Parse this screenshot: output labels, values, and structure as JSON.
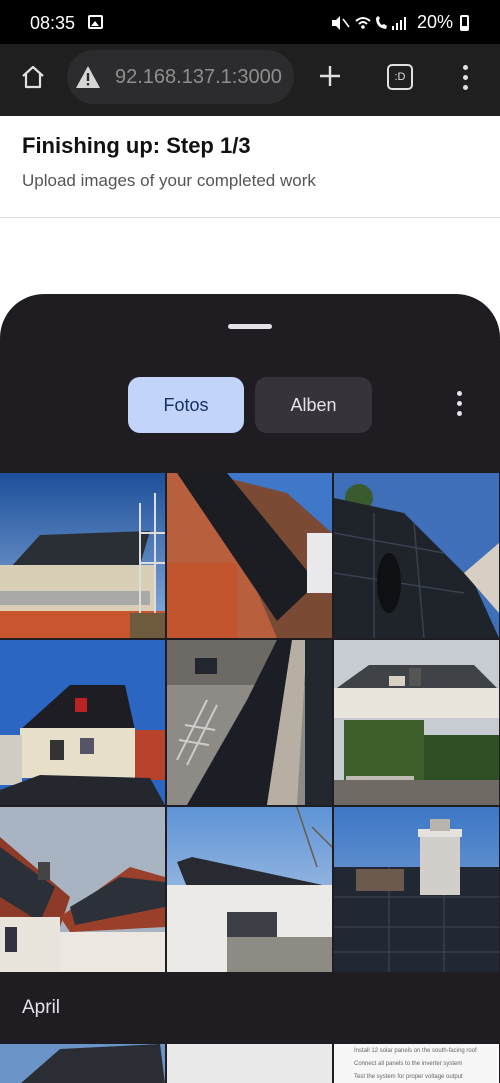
{
  "status_bar": {
    "time": "08:35",
    "battery": "20%"
  },
  "browser": {
    "url": "92.168.137.1:3000",
    "tabs_label": ":D"
  },
  "page": {
    "title": "Finishing up: Step 1/3",
    "subtitle": "Upload images of your completed work"
  },
  "picker": {
    "tabs": [
      {
        "label": "Fotos",
        "selected": true
      },
      {
        "label": "Alben",
        "selected": false
      }
    ],
    "month_label": "April",
    "photos": [
      "house-with-solar-roof-scaffolding",
      "roof-solar-panel-closeup",
      "solar-panels-with-shadow",
      "white-house-dark-roof-solar",
      "roof-solar-panel-ladder",
      "house-with-dormer-solar",
      "red-tile-roof-solar",
      "apartment-roof-solar",
      "chimney-solar-panels"
    ],
    "note_lines": [
      "Install 12 solar panels on the south-facing roof",
      "Connect all panels to the inverter system",
      "Test the system for proper voltage output"
    ]
  },
  "colors": {
    "sheet_bg": "#1f1d22",
    "selected_tab": "#c3d4fb",
    "unselected_tab": "#36343a"
  }
}
